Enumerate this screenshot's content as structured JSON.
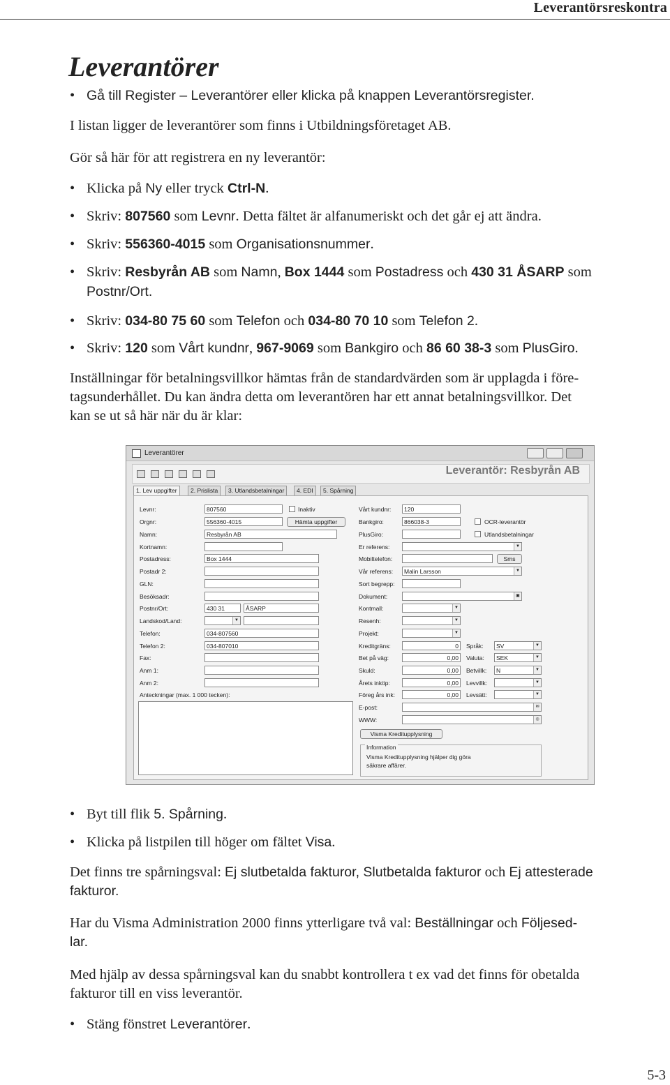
{
  "header": {
    "running_title": "Leverantörsreskontra"
  },
  "heading": "Leverantörer",
  "b1": {
    "pre": "Gå till ",
    "p1": "Register – Leverantörer",
    "mid": " eller klicka på knappen ",
    "p2": "Leverantörsregister",
    "end": "."
  },
  "p1": "I listan ligger de leverantörer som finns i Utbildningsföretaget AB.",
  "p2": "Gör så här för att registrera en ny leverantör:",
  "b2": {
    "pre": "Klicka på ",
    "p1": "Ny",
    "mid": " eller tryck ",
    "p2": "Ctrl-N",
    "end": "."
  },
  "b3": {
    "pre": "Skriv: ",
    "v1": "807560",
    "mid": " som ",
    "p1": "Levnr",
    "end": ". Detta fältet är alfanumeriskt och det går ej att ändra."
  },
  "b4": {
    "pre": "Skriv: ",
    "v1": "556360-4015",
    "mid": " som ",
    "p1": "Organisationsnummer",
    "end": "."
  },
  "b5": {
    "pre": "Skriv: ",
    "v1": "Resbyrån AB",
    "m1": " som ",
    "p1": "Namn",
    "m2": ", ",
    "v2": "Box 1444",
    "m3": " som ",
    "p2": "Postadress",
    "m4": " och ",
    "v3": "430 31 ÅSARP",
    "m5": " som",
    "line2": "Postnr/Ort."
  },
  "b6": {
    "pre": "Skriv: ",
    "v1": "034-80 75 60",
    "m1": " som ",
    "p1": "Telefon",
    "m2": " och ",
    "v2": "034-80 70 10",
    "m3": " som ",
    "p2": "Telefon 2",
    "end": "."
  },
  "b7": {
    "pre": "Skriv: ",
    "v1": "120",
    "m1": " som ",
    "p1": "Vårt kundnr",
    "m2": ", ",
    "v2": "967-9069",
    "m3": " som ",
    "p2": "Bankgiro",
    "m4": " och ",
    "v3": "86 60 38-3",
    "m5": " som ",
    "p3": "PlusGiro",
    "end": "."
  },
  "p3": {
    "l1": "Inställningar för betalningsvillkor hämtas från de standardvärden som är upplagda i före-",
    "l2": "tagsunderhållet. Du kan ändra detta om leverantören har ett annat betalningsvillkor. Det",
    "l3": "kan se ut så här när du är klar:"
  },
  "screenshot": {
    "window_title": "Leverantörer",
    "big_title": "Leverantör: Resbyrån AB",
    "tabs": [
      "1. Lev uppgifter",
      "2. Prislista",
      "3. Utlandsbetalningar",
      "4. EDI",
      "5. Spårning"
    ],
    "left_labels": [
      "Levnr:",
      "Orgnr:",
      "Namn:",
      "Kortnamn:",
      "Postadress:",
      "Postadr 2:",
      "GLN:",
      "Besöksadr:",
      "Postnr/Ort:",
      "Landskod/Land:",
      "Telefon:",
      "Telefon 2:",
      "Fax:",
      "Anm 1:",
      "Anm 2:",
      "Anteckningar (max. 1 000 tecken):"
    ],
    "left_values": {
      "levnr": "807560",
      "orgnr": "556360-4015",
      "namn": "Resbyrån AB",
      "postadress": "Box 1444",
      "postnr": "430 31",
      "ort": "ÅSARP",
      "telefon": "034-807560",
      "telefon2": "034-807010"
    },
    "inaktiv": "Inaktiv",
    "hamta": "Hämta uppgifter",
    "mid_labels": [
      "Vårt kundnr:",
      "Bankgiro:",
      "PlusGiro:",
      "Er referens:",
      "Mobiltelefon:",
      "Vår referens:",
      "Sort begrepp:",
      "Dokument:",
      "Kontmall:",
      "Resenh:",
      "Projekt:",
      "Kreditgräns:",
      "Bet på väg:",
      "Skuld:",
      "Årets inköp:",
      "Föreg års ink:",
      "E-post:",
      "WWW:"
    ],
    "mid_values": {
      "kundnr": "120",
      "bankgiro": "866038-3",
      "var_ref": "Malin Larsson",
      "kredit": "0",
      "bet": "0,00",
      "skuld": "0,00",
      "arets": "0,00",
      "foreg": "0,00"
    },
    "ocr": "OCR-leverantör",
    "utlands": "Utlandsbetalningar",
    "sms": "Sms",
    "right_labels": [
      "Språk:",
      "Valuta:",
      "Betvillk:",
      "Levvillk:",
      "Levsätt:"
    ],
    "right_values": [
      "SV",
      "SEK",
      "N",
      "",
      ""
    ],
    "visma_btn": "Visma Kreditupplysning",
    "info_title": "Information",
    "info_l1": "Visma Kreditupplysning hjälper dig göra",
    "info_l2": "säkrare affärer."
  },
  "b8": {
    "pre": "Byt till flik ",
    "p1": "5. Spårning",
    "end": "."
  },
  "b9": {
    "pre": "Klicka på listpilen till höger om fältet ",
    "p1": "Visa",
    "end": "."
  },
  "p4": {
    "pre": "Det finns tre spårningsval: ",
    "p1": "Ej slutbetalda fakturor",
    "m1": ", ",
    "p2": "Slutbetalda fakturor",
    "m2": " och ",
    "p3": "Ej attesterade",
    "l2": "fakturor."
  },
  "p5": {
    "pre": "Har du Visma Administration 2000 finns ytterligare två val: ",
    "p1": "Beställningar",
    "m1": " och ",
    "p2": "Följesed-",
    "l2": "lar."
  },
  "p6": {
    "l1": "Med hjälp av dessa spårningsval kan du snabbt kontrollera t ex vad det finns för obetalda",
    "l2": "fakturor till en viss leverantör."
  },
  "b10": {
    "pre": "Stäng fönstret ",
    "p1": "Leverantörer",
    "end": "."
  },
  "page_number": "5-3"
}
